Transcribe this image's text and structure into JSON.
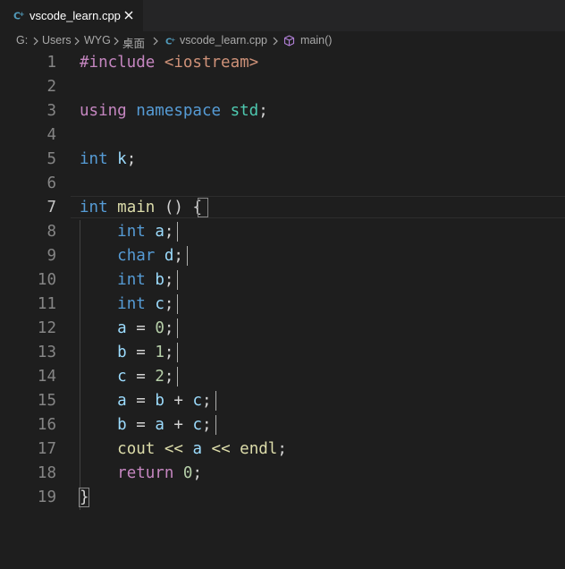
{
  "tab": {
    "label": "vscode_learn.cpp",
    "icon": "cpp-file-icon",
    "close_icon": "close-icon"
  },
  "breadcrumb": {
    "items": [
      "G:",
      "Users",
      "WYG",
      "桌面",
      "vscode_learn.cpp",
      "main()"
    ]
  },
  "editor": {
    "lines": [
      {
        "n": "1",
        "tokens": [
          {
            "t": "#include ",
            "c": "inc"
          },
          {
            "t": "<iostream>",
            "c": "str"
          }
        ]
      },
      {
        "n": "2",
        "tokens": []
      },
      {
        "n": "3",
        "tokens": [
          {
            "t": "using ",
            "c": "ctl"
          },
          {
            "t": "namespace ",
            "c": "kw"
          },
          {
            "t": "std",
            "c": "ns"
          },
          {
            "t": ";",
            "c": "op"
          }
        ]
      },
      {
        "n": "4",
        "tokens": []
      },
      {
        "n": "5",
        "tokens": [
          {
            "t": "int ",
            "c": "kw"
          },
          {
            "t": "k",
            "c": "var"
          },
          {
            "t": ";",
            "c": "op"
          }
        ]
      },
      {
        "n": "6",
        "tokens": []
      },
      {
        "n": "7",
        "tokens": [
          {
            "t": "int ",
            "c": "kw"
          },
          {
            "t": "main",
            "c": "fn"
          },
          {
            "t": " () ",
            "c": "op"
          },
          {
            "t": "{",
            "c": "brace"
          }
        ]
      },
      {
        "n": "8",
        "tokens": [
          {
            "t": "    ",
            "c": "op"
          },
          {
            "t": "int ",
            "c": "kw"
          },
          {
            "t": "a",
            "c": "var"
          },
          {
            "t": ";",
            "c": "op"
          }
        ]
      },
      {
        "n": "9",
        "tokens": [
          {
            "t": "    ",
            "c": "op"
          },
          {
            "t": "char ",
            "c": "kw"
          },
          {
            "t": "d",
            "c": "var"
          },
          {
            "t": ";",
            "c": "op"
          }
        ]
      },
      {
        "n": "10",
        "tokens": [
          {
            "t": "    ",
            "c": "op"
          },
          {
            "t": "int ",
            "c": "kw"
          },
          {
            "t": "b",
            "c": "var"
          },
          {
            "t": ";",
            "c": "op"
          }
        ]
      },
      {
        "n": "11",
        "tokens": [
          {
            "t": "    ",
            "c": "op"
          },
          {
            "t": "int ",
            "c": "kw"
          },
          {
            "t": "c",
            "c": "var"
          },
          {
            "t": ";",
            "c": "op"
          }
        ]
      },
      {
        "n": "12",
        "tokens": [
          {
            "t": "    ",
            "c": "op"
          },
          {
            "t": "a",
            "c": "var"
          },
          {
            "t": " = ",
            "c": "op"
          },
          {
            "t": "0",
            "c": "num"
          },
          {
            "t": ";",
            "c": "op"
          }
        ]
      },
      {
        "n": "13",
        "tokens": [
          {
            "t": "    ",
            "c": "op"
          },
          {
            "t": "b",
            "c": "var"
          },
          {
            "t": " = ",
            "c": "op"
          },
          {
            "t": "1",
            "c": "num"
          },
          {
            "t": ";",
            "c": "op"
          }
        ]
      },
      {
        "n": "14",
        "tokens": [
          {
            "t": "    ",
            "c": "op"
          },
          {
            "t": "c",
            "c": "var"
          },
          {
            "t": " = ",
            "c": "op"
          },
          {
            "t": "2",
            "c": "num"
          },
          {
            "t": ";",
            "c": "op"
          }
        ]
      },
      {
        "n": "15",
        "tokens": [
          {
            "t": "    ",
            "c": "op"
          },
          {
            "t": "a",
            "c": "var"
          },
          {
            "t": " = ",
            "c": "op"
          },
          {
            "t": "b",
            "c": "var"
          },
          {
            "t": " + ",
            "c": "op"
          },
          {
            "t": "c",
            "c": "var"
          },
          {
            "t": ";",
            "c": "op"
          }
        ]
      },
      {
        "n": "16",
        "tokens": [
          {
            "t": "    ",
            "c": "op"
          },
          {
            "t": "b",
            "c": "var"
          },
          {
            "t": " = ",
            "c": "op"
          },
          {
            "t": "a",
            "c": "var"
          },
          {
            "t": " + ",
            "c": "op"
          },
          {
            "t": "c",
            "c": "var"
          },
          {
            "t": ";",
            "c": "op"
          }
        ]
      },
      {
        "n": "17",
        "tokens": [
          {
            "t": "    ",
            "c": "op"
          },
          {
            "t": "cout",
            "c": "fn"
          },
          {
            "t": " << ",
            "c": "fn"
          },
          {
            "t": "a",
            "c": "var"
          },
          {
            "t": " << ",
            "c": "fn"
          },
          {
            "t": "endl",
            "c": "fn"
          },
          {
            "t": ";",
            "c": "op"
          }
        ]
      },
      {
        "n": "18",
        "tokens": [
          {
            "t": "    ",
            "c": "op"
          },
          {
            "t": "return ",
            "c": "ctl"
          },
          {
            "t": "0",
            "c": "num"
          },
          {
            "t": ";",
            "c": "op"
          }
        ]
      },
      {
        "n": "19",
        "tokens": [
          {
            "t": "}",
            "c": "brace"
          }
        ]
      }
    ],
    "active_line": "7"
  },
  "colors": {
    "background": "#1e1e1e",
    "tabbar": "#252526",
    "keyword": "#569cd6",
    "control": "#c586c0",
    "string": "#ce9178",
    "type": "#4ec9b0",
    "variable": "#9cdcfe",
    "function": "#dcdcaa",
    "number": "#b5cea8",
    "cpp_icon": "#519aba"
  }
}
